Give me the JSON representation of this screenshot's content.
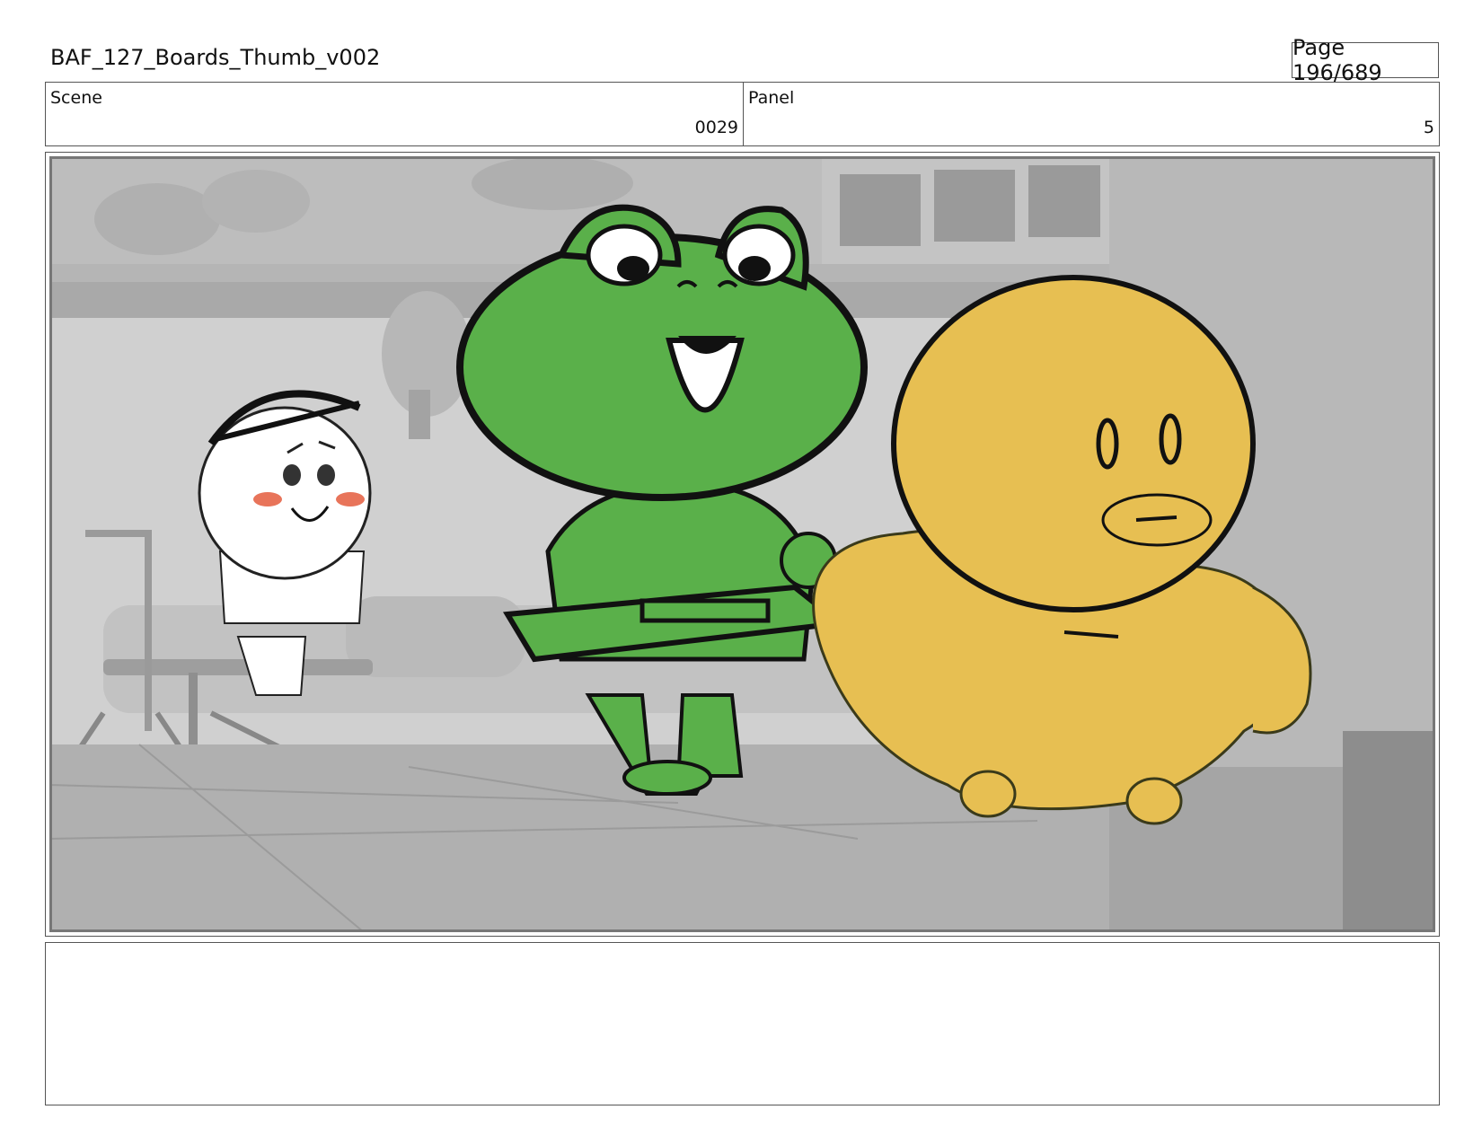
{
  "header": {
    "title": "BAF_127_Boards_Thumb_v002",
    "page": "Page 196/689"
  },
  "scene": {
    "label": "Scene",
    "value": "0029"
  },
  "panel": {
    "label": "Panel",
    "value": "5"
  },
  "artwork": {
    "characters": [
      "frog",
      "duck",
      "kid"
    ],
    "colors": {
      "frog_green": "#5ab04a",
      "duck_yellow": "#e7bf52",
      "line": "#111111",
      "background_gray": "#c9c9c9"
    }
  },
  "notes": {
    "text": ""
  }
}
